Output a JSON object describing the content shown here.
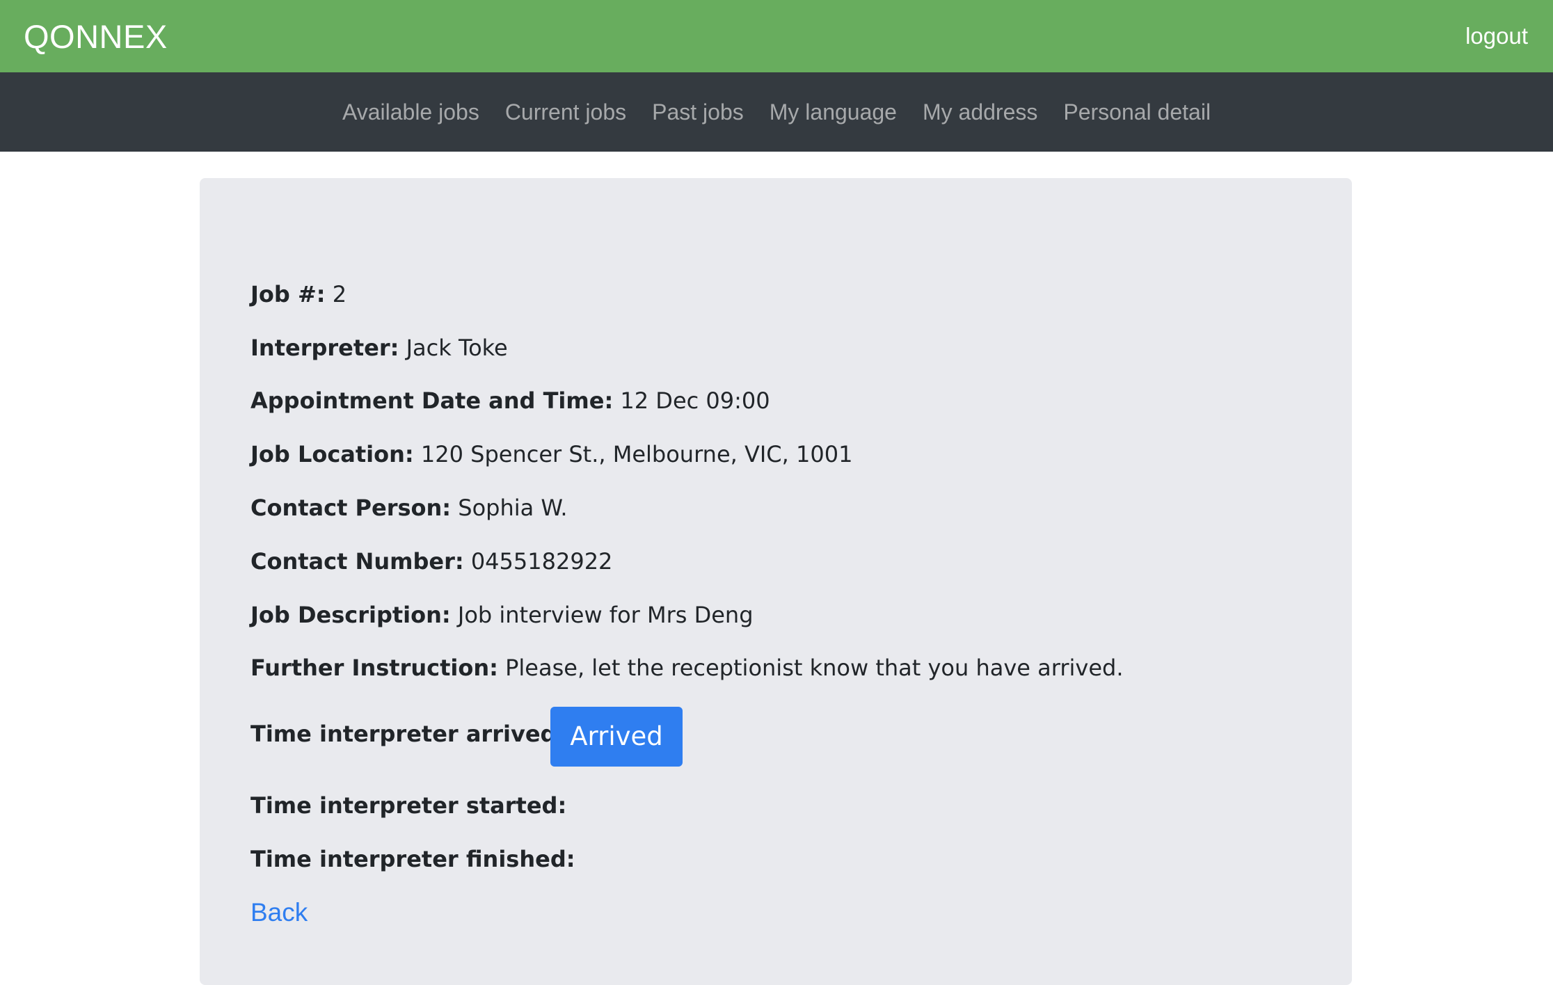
{
  "header": {
    "brand": "QONNEX",
    "logout_label": "logout"
  },
  "nav": {
    "items": [
      {
        "label": "Available jobs"
      },
      {
        "label": "Current jobs"
      },
      {
        "label": "Past jobs"
      },
      {
        "label": "My language"
      },
      {
        "label": "My address"
      },
      {
        "label": "Personal detail"
      }
    ]
  },
  "job": {
    "number_label": "Job #:",
    "number": "2",
    "interpreter_label": "Interpreter:",
    "interpreter": "Jack Toke",
    "appointment_label": "Appointment Date and Time:",
    "appointment": "12 Dec 09:00",
    "location_label": "Job Location:",
    "location": "120 Spencer St., Melbourne, VIC, 1001",
    "contact_person_label": "Contact Person:",
    "contact_person": "Sophia W.",
    "contact_number_label": "Contact Number:",
    "contact_number": "0455182922",
    "description_label": "Job Description:",
    "description": "Job interview for Mrs Deng",
    "instruction_label": "Further Instruction:",
    "instruction": "Please, let the receptionist know that you have arrived.",
    "arrived_label": "Time interpreter arrived:",
    "arrived_button": "Arrived",
    "started_label": "Time interpreter started:",
    "finished_label": "Time interpreter finished:"
  },
  "back_label": "Back",
  "colors": {
    "header_bg": "#68ad5e",
    "nav_bg": "#343a40",
    "card_bg": "#e9eaee",
    "primary": "#2f7ef0"
  }
}
